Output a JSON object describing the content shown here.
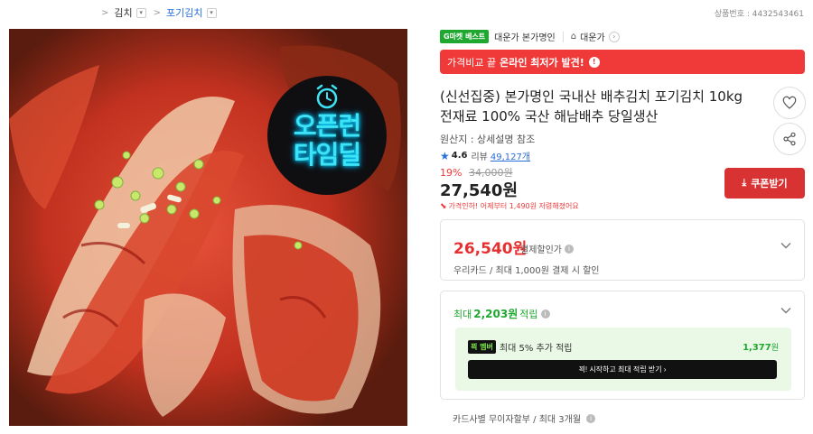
{
  "breadcrumb": {
    "items": [
      {
        "label": "김치",
        "type": "normal"
      },
      {
        "label": "포기김치",
        "type": "link"
      }
    ],
    "separator": ">",
    "dropdown_icon": "chevron-down-icon"
  },
  "product_no": "상품번호 : 4432543461",
  "image": {
    "badge_line1": "오픈런",
    "badge_line2": "타임딜",
    "badge_icon": "alarm-clock-icon"
  },
  "tags": {
    "gmarket": "G마켓 베스트",
    "seller": "대운가 본가명인",
    "store": "대운가",
    "store_icon": "home-icon"
  },
  "promo_banner": {
    "text_normal": "가격비교 끝",
    "text_bold": "온라인 최저가 발견!",
    "icon": "info-icon"
  },
  "title_line1": "(신선집중) 본가명인 국내산 배추김치 포기김치 10kg",
  "title_line2": "전재료 100% 국산 해남배추 당일생산",
  "origin": "원산지 : 상세설명 참조",
  "rating": {
    "score": "4.6",
    "review_label": "리뷰",
    "review_count": "49,127개"
  },
  "price": {
    "discount": "19%",
    "original": "34,000원",
    "sale": "27,540원",
    "drop_notice": "가격인하! 어제부터 1,490원 저렴해졌어요"
  },
  "coupon_button": "쿠폰받기",
  "card_discount": {
    "price": "26,540원",
    "label": "결제할인가",
    "sub": "우리카드 / 최대 1,000원 결제 시 할인"
  },
  "points": {
    "prefix": "최대",
    "amount": "2,203원",
    "suffix": "적립",
    "smile_badge": "꾁 멤버",
    "smile_text": "최대 5% 추가 적립",
    "smile_amount": "1,377",
    "smile_unit": "원",
    "smile_cta": "꾁! 시작하고 최대 적립 받기 ›"
  },
  "installment": "카드사별 무이자할부 / 최대 3개월",
  "colors": {
    "accent_red": "#f03a3a",
    "coupon_red": "#d93232",
    "green": "#1fa830",
    "link_blue": "#2a6fd8"
  }
}
